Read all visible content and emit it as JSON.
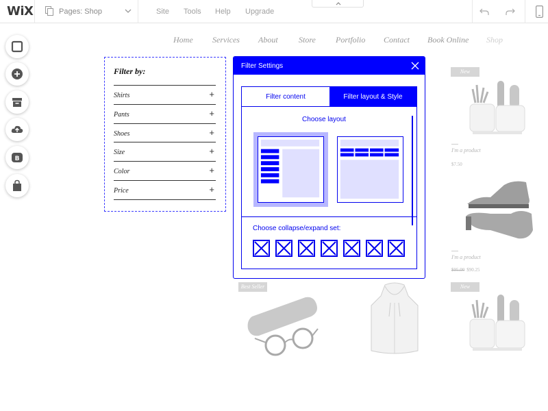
{
  "topbar": {
    "logo": "WiX",
    "pages_label": "Pages: Shop",
    "menu": [
      "Site",
      "Tools",
      "Help",
      "Upgrade"
    ]
  },
  "left_toolbar": [
    "pages-square-icon",
    "add-icon",
    "app-market-icon",
    "upload-icon",
    "blog-icon",
    "store-bag-icon"
  ],
  "site_nav": {
    "links": [
      "Home",
      "Services",
      "About",
      "Store",
      "Portfolio",
      "Contact",
      "Book Online",
      "Shop"
    ],
    "active": "Shop"
  },
  "filter_panel": {
    "title": "Filter by:",
    "items": [
      "Shirts",
      "Pants",
      "Shoes",
      "Size",
      "Color",
      "Price"
    ],
    "expand_symbol": "+"
  },
  "dialog": {
    "title": "Filter Settings",
    "tabs": [
      {
        "label": "Filter content",
        "selected": false
      },
      {
        "label": "Filter layout & Style",
        "selected": true
      }
    ],
    "choose_layout_label": "Choose layout",
    "layouts": [
      "sidebar-layout",
      "top-bar-layout"
    ],
    "selected_layout": 0,
    "collapse_label": "Choose collapse/expand set:",
    "collapse_option_count": 7
  },
  "products": {
    "badges": {
      "new": "New",
      "best_seller": "Best Seller"
    },
    "items": [
      {
        "name": "I'm a product",
        "price": "$7.50",
        "old_price": ""
      },
      {
        "name": "I'm a product",
        "price": "$90.25",
        "old_price": "$95.00"
      }
    ]
  },
  "colors": {
    "accent": "#0000ff",
    "accent_light": "#b7b7ff",
    "panel_fill": "#e0e0ff"
  }
}
